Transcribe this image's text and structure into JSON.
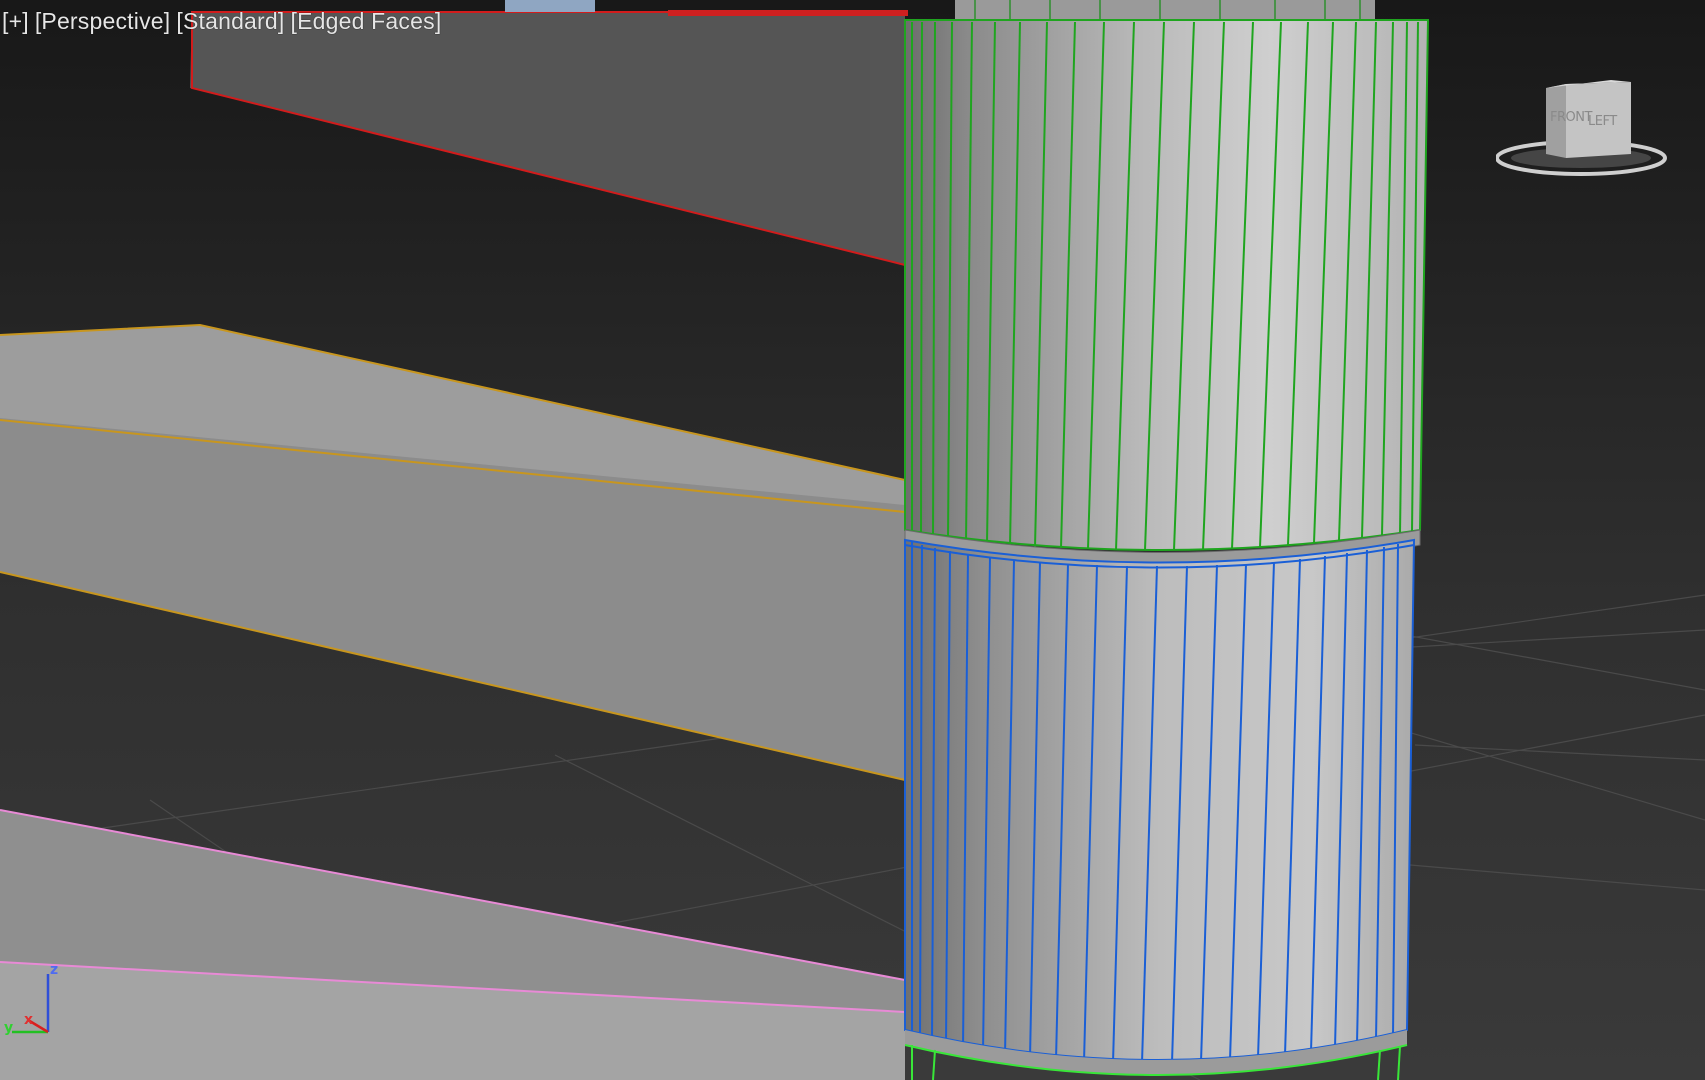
{
  "viewport": {
    "labels": [
      {
        "id": "plus",
        "text": "[+]"
      },
      {
        "id": "view",
        "text": "[Perspective]"
      },
      {
        "id": "shading",
        "text": "[Standard]"
      },
      {
        "id": "display",
        "text": "[Edged Faces]"
      }
    ]
  },
  "viewcube": {
    "faces": {
      "front": "FRONT",
      "left": "LEFT"
    }
  },
  "axis_tripod": {
    "x_label": "x",
    "y_label": "y",
    "z_label": "z"
  },
  "colors": {
    "background_top": "#1b1b1b",
    "background_bottom": "#3c3c3c",
    "selection_red": "#d21c1c",
    "wire_green": "#1fa51f",
    "wire_blue": "#1a5fd6",
    "wire_orange": "#c8961e",
    "wire_pink": "#e88ad6",
    "wire_lime": "#39e639"
  }
}
